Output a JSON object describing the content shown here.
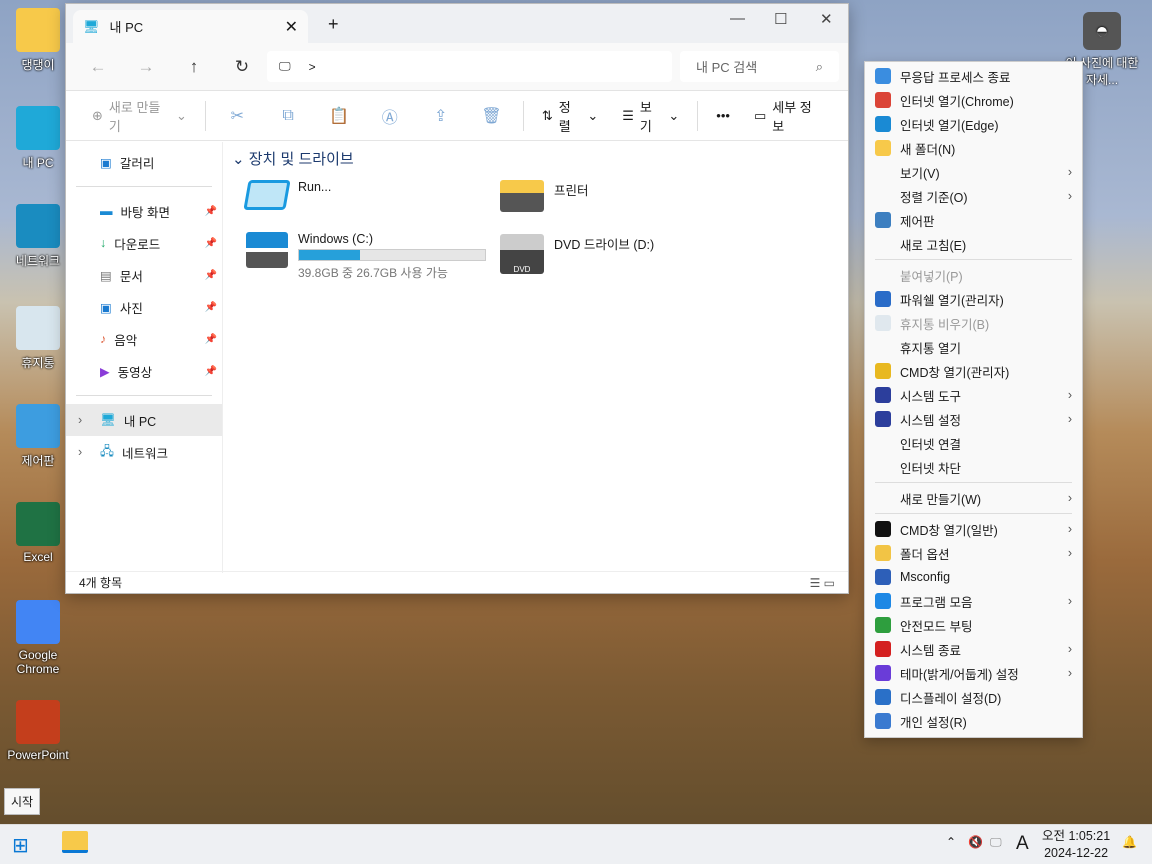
{
  "desktop": {
    "icons": [
      {
        "label": "댕댕이",
        "icon": "folder-icon",
        "color": "#f7c94a"
      },
      {
        "label": "내 PC",
        "icon": "monitor-icon",
        "color": "#1fa9d8"
      },
      {
        "label": "네트워크",
        "icon": "network-icon",
        "color": "#1a8cc0"
      },
      {
        "label": "휴지통",
        "icon": "recycle-bin-icon",
        "color": "#d8e6ee"
      },
      {
        "label": "제어판",
        "icon": "control-panel-icon",
        "color": "#3d9de0"
      },
      {
        "label": "Excel",
        "icon": "excel-icon",
        "color": "#1f7244"
      },
      {
        "label": "Google Chrome",
        "icon": "chrome-icon",
        "color": "#4285f4"
      },
      {
        "label": "PowerPoint",
        "icon": "powerpoint-icon",
        "color": "#c43e1c"
      }
    ],
    "right_icon": {
      "label": "이 사진에 대한 자세...",
      "icon": "photo-info-icon"
    }
  },
  "explorer": {
    "tab_title": "내 PC",
    "address_sep": ">",
    "search_placeholder": "내 PC 검색",
    "toolbar": {
      "new": "새로 만들기",
      "sort": "정렬",
      "view": "보기",
      "more": "•••",
      "details": "세부 정보"
    },
    "sidebar": {
      "gallery": "갈러리",
      "pinned": [
        "바탕 화면",
        "다운로드",
        "문서",
        "사진",
        "음악",
        "동영상"
      ],
      "this_pc": "내 PC",
      "network": "네트워크"
    },
    "section": "장치 및 드라이브",
    "items": {
      "run": "Run...",
      "printer": "프린터",
      "c_name": "Windows (C:)",
      "c_free": "39.8GB 중 26.7GB 사용 가능",
      "c_used_percent": 33,
      "dvd": "DVD 드라이브 (D:)",
      "dvd_badge": "DVD"
    },
    "status": "4개 항목"
  },
  "menu": [
    {
      "label": "무응답 프로세스 종료",
      "icon": "process-icon",
      "color": "#3a8de0"
    },
    {
      "label": "인터넷 열기(Chrome)",
      "icon": "chrome-icon",
      "color": "#db4437"
    },
    {
      "label": "인터넷 열기(Edge)",
      "icon": "edge-icon",
      "color": "#1a8ad4"
    },
    {
      "label": "새 폴더(N)",
      "icon": "folder-icon",
      "color": "#f7c94a"
    },
    {
      "label": "보기(V)",
      "sub": true
    },
    {
      "label": "정렬 기준(O)",
      "sub": true
    },
    {
      "label": "제어판",
      "icon": "control-panel-icon",
      "color": "#3d7fc0"
    },
    {
      "label": "새로 고침(E)"
    },
    {
      "sep": true
    },
    {
      "label": "붙여넣기(P)",
      "disabled": true
    },
    {
      "label": "파워쉘 열기(관리자)",
      "icon": "powershell-icon",
      "color": "#2a6cc8"
    },
    {
      "label": "휴지통 비우기(B)",
      "icon": "recycle-bin-icon",
      "color": "#c8d8e4",
      "disabled": true
    },
    {
      "label": "휴지통 열기"
    },
    {
      "label": "CMD창 열기(관리자)",
      "icon": "shield-icon",
      "color": "#e8b820"
    },
    {
      "label": "시스템 도구",
      "icon": "system-tools-icon",
      "color": "#2c3e9c",
      "sub": true
    },
    {
      "label": "시스템 설정",
      "icon": "system-settings-icon",
      "color": "#2c3e9c",
      "sub": true
    },
    {
      "label": "인터넷 연결"
    },
    {
      "label": "인터넷 차단"
    },
    {
      "sep": true
    },
    {
      "label": "새로 만들기(W)",
      "sub": true
    },
    {
      "sep": true
    },
    {
      "label": "CMD창 열기(일반)",
      "icon": "cmd-icon",
      "color": "#111111",
      "sub": true
    },
    {
      "label": "폴더 옵션",
      "icon": "folder-options-icon",
      "color": "#f2c445",
      "sub": true
    },
    {
      "label": "Msconfig",
      "icon": "msconfig-icon",
      "color": "#2d5fb8"
    },
    {
      "label": "프로그램 모음",
      "icon": "accessibility-icon",
      "color": "#1e88e5",
      "sub": true
    },
    {
      "label": "안전모드 부팅",
      "icon": "safe-shield-icon",
      "color": "#2e9e3e"
    },
    {
      "label": "시스템 종료",
      "icon": "power-icon",
      "color": "#d42020",
      "sub": true
    },
    {
      "label": "테마(밝게/어둡게) 설정",
      "icon": "theme-icon",
      "color": "#6a3cd8",
      "sub": true
    },
    {
      "label": "디스플레이 설정(D)",
      "icon": "display-settings-icon",
      "color": "#2a70c8"
    },
    {
      "label": "개인 설정(R)",
      "icon": "brush-icon",
      "color": "#3a7ad0"
    }
  ],
  "taskbar": {
    "tooltip": "시작",
    "time": "오전 1:05:21",
    "date": "2024-12-22",
    "ime": "A"
  }
}
